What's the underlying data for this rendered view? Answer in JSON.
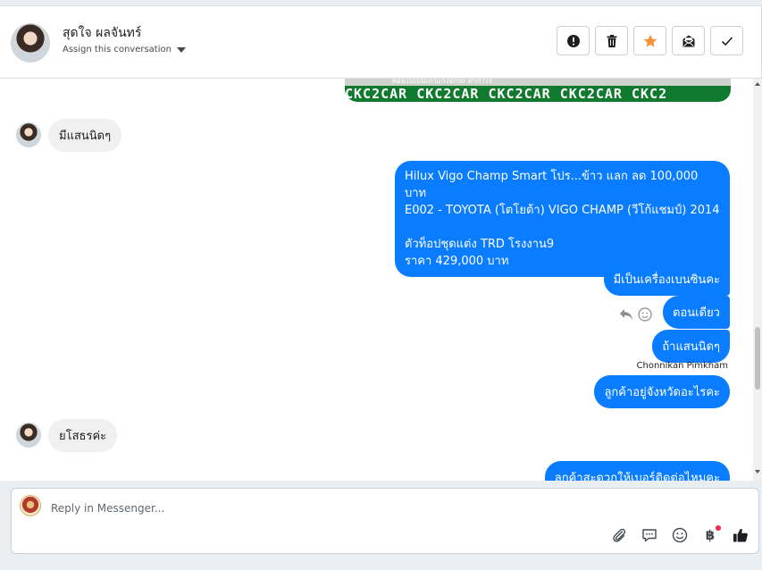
{
  "header": {
    "contact_name": "สุดใจ ผลจันทร์",
    "assign_label": "Assign this conversation",
    "actions": [
      "alert-icon",
      "trash-icon",
      "star-icon",
      "mark-unread-icon",
      "check-icon"
    ],
    "star_color": "#f7923b"
  },
  "banner": {
    "subtitle": "ท้อนไปเป็นเถ้าแก่ใจกรถ ทำกำไร",
    "brand": "CKC2CAR CKC2CAR CKC2CAR CKC2CAR CKC2"
  },
  "messages": [
    {
      "id": "m1",
      "dir": "in",
      "text": "มีแสนนิดๆ"
    },
    {
      "id": "m2",
      "dir": "out",
      "lines": [
        "Hilux Vigo Champ Smart โปร...ข้าว แลก ลด 100,000 บาท",
        "E002 - TOYOTA (โตโยต้า) VIGO CHAMP (วีโก้แชมป์) 2014",
        "",
        " ตัวท็อปชุดแต่ง TRD โรงงาน9",
        "ราคา 429,000 บาท"
      ]
    },
    {
      "id": "m3",
      "dir": "out",
      "text": "มีเป็นเครื่องเบนซินคะ"
    },
    {
      "id": "m4",
      "dir": "out",
      "text": "ตอนเดียว"
    },
    {
      "id": "m5",
      "dir": "out",
      "text": "ถ้าแสนนิดๆ",
      "sender": "Chonnikan Pimkham"
    },
    {
      "id": "m6",
      "dir": "out",
      "text": "ลูกค้าอยู่จังหวัดอะไรคะ"
    },
    {
      "id": "m7",
      "dir": "in",
      "text": "ยโสธรค่ะ"
    },
    {
      "id": "m8",
      "dir": "out",
      "text": "ลูกค้าสะดวกให้เบอร์ติดต่อไหมคะ"
    }
  ],
  "composer": {
    "placeholder": "Reply in Messenger...",
    "tools": [
      "attachment-icon",
      "saved-reply-icon",
      "emoji-icon",
      "baht-icon",
      "like-icon"
    ],
    "baht_symbol": "฿"
  },
  "colors": {
    "outgoing_bubble": "#0a7cff",
    "incoming_bubble": "#f0f0f0",
    "notification_dot": "#f02849"
  }
}
